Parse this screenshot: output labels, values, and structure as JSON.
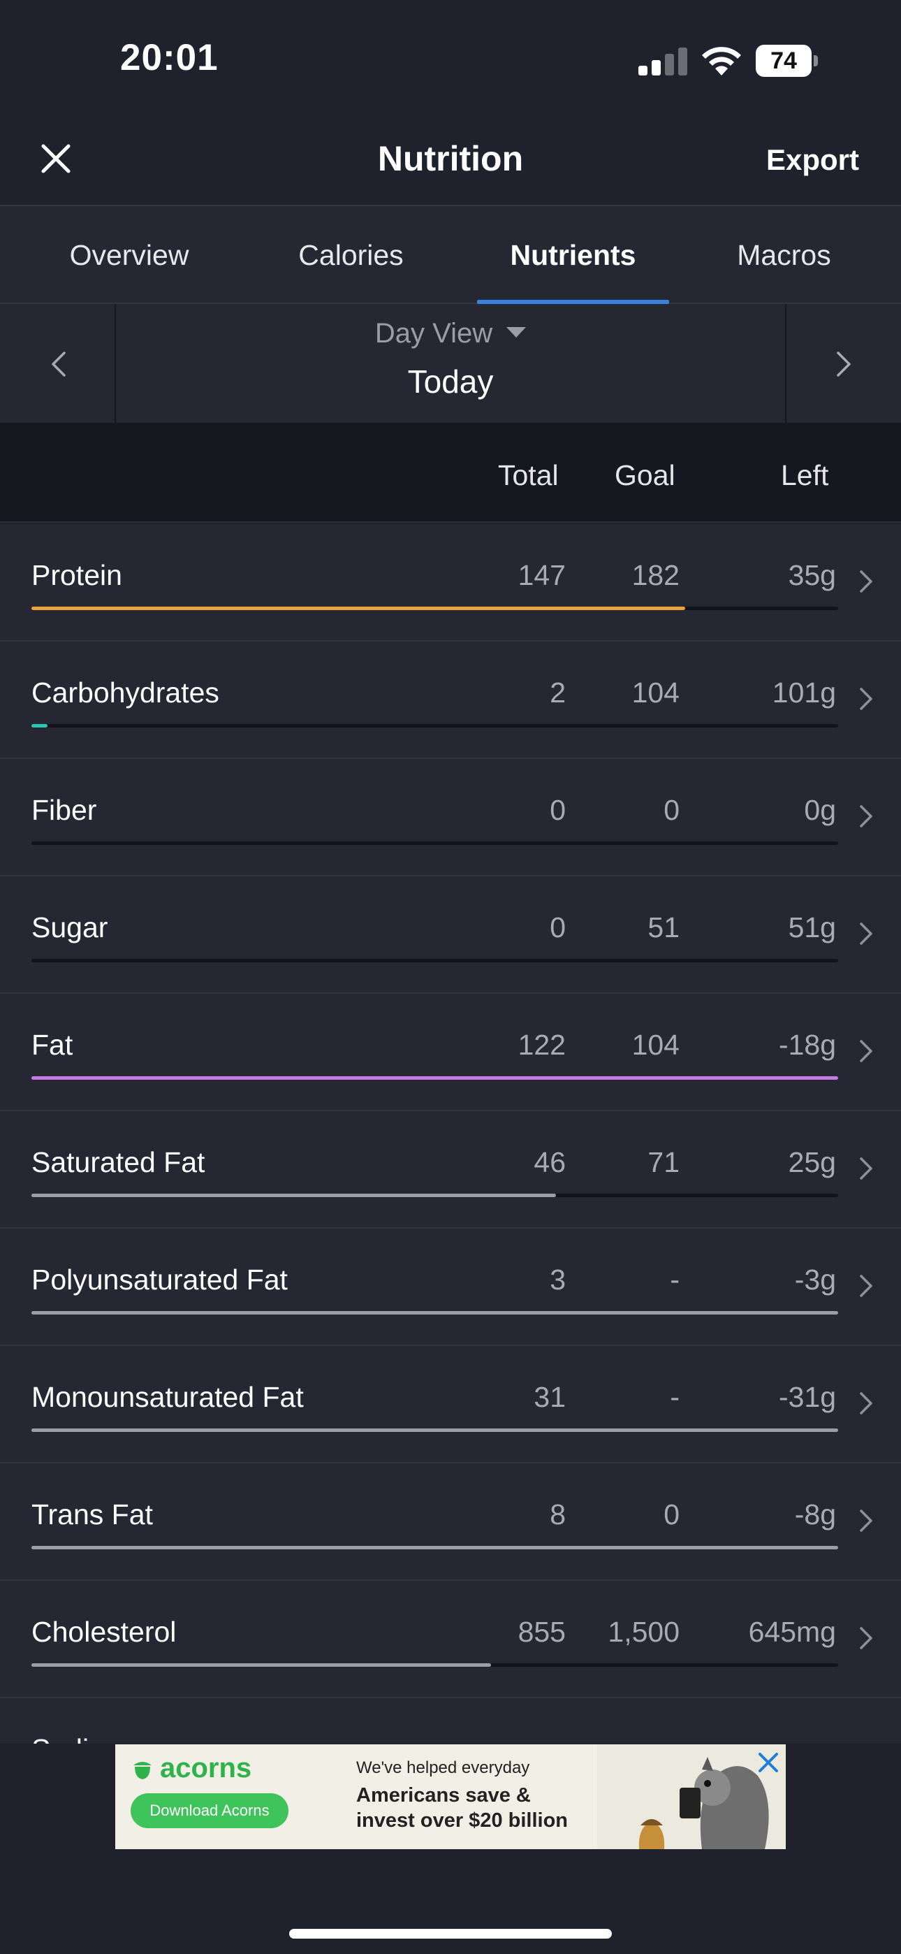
{
  "status_bar": {
    "time": "20:01",
    "battery": "74"
  },
  "header": {
    "title": "Nutrition",
    "export_label": "Export"
  },
  "tabs": [
    {
      "label": "Overview",
      "active": false
    },
    {
      "label": "Calories",
      "active": false
    },
    {
      "label": "Nutrients",
      "active": true
    },
    {
      "label": "Macros",
      "active": false
    }
  ],
  "day_nav": {
    "view_label": "Day View",
    "value": "Today"
  },
  "table": {
    "columns": {
      "total": "Total",
      "goal": "Goal",
      "left": "Left"
    },
    "rows": [
      {
        "label": "Protein",
        "total": "147",
        "goal": "182",
        "left": "35g",
        "progress": 0.81,
        "color": "#e8a33a"
      },
      {
        "label": "Carbohydrates",
        "total": "2",
        "goal": "104",
        "left": "101g",
        "progress": 0.02,
        "color": "#2cc4b5"
      },
      {
        "label": "Fiber",
        "total": "0",
        "goal": "0",
        "left": "0g",
        "progress": 0,
        "color": "#9c9ea6"
      },
      {
        "label": "Sugar",
        "total": "0",
        "goal": "51",
        "left": "51g",
        "progress": 0,
        "color": "#9c9ea6"
      },
      {
        "label": "Fat",
        "total": "122",
        "goal": "104",
        "left": "-18g",
        "progress": 1.0,
        "color": "#c57be0"
      },
      {
        "label": "Saturated Fat",
        "total": "46",
        "goal": "71",
        "left": "25g",
        "progress": 0.65,
        "color": "#9c9ea6"
      },
      {
        "label": "Polyunsaturated Fat",
        "total": "3",
        "goal": "-",
        "left": "-3g",
        "progress": 1.0,
        "color": "#9c9ea6"
      },
      {
        "label": "Monounsaturated Fat",
        "total": "31",
        "goal": "-",
        "left": "-31g",
        "progress": 1.0,
        "color": "#9c9ea6"
      },
      {
        "label": "Trans Fat",
        "total": "8",
        "goal": "0",
        "left": "-8g",
        "progress": 1.0,
        "color": "#9c9ea6"
      },
      {
        "label": "Cholesterol",
        "total": "855",
        "goal": "1,500",
        "left": "645mg",
        "progress": 0.57,
        "color": "#9c9ea6"
      },
      {
        "label": "Sodium",
        "total": "",
        "goal": "",
        "left": "",
        "progress": 0,
        "color": "#9c9ea6"
      }
    ]
  },
  "ad": {
    "brand": "acorns",
    "cta": "Download Acorns",
    "headline_small": "We've helped everyday",
    "headline_big": "Americans save & invest over $20 billion"
  }
}
